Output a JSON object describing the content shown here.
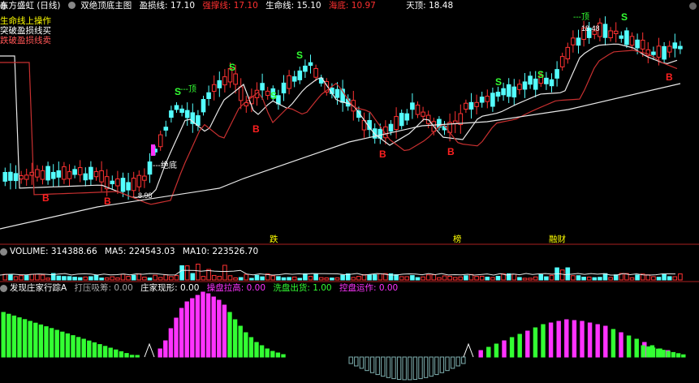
{
  "main": {
    "stock_name": "东方盛虹 (日线)",
    "indicator_name": "双绝顶底主图",
    "params": [
      {
        "label": "盈损线: 17.10",
        "color": "#ffffff"
      },
      {
        "label": "强撑线: 17.10",
        "color": "#ff3030"
      },
      {
        "label": "生命线: 15.10",
        "color": "#ffffff"
      },
      {
        "label": "海底: 10.97",
        "color": "#ff3030"
      },
      {
        "label": "天顶: 18.48",
        "color": "#ffffff"
      }
    ],
    "legend": [
      {
        "text": "生命线上操作",
        "color": "#ffff00"
      },
      {
        "text": "突破盈损线买",
        "color": "#ffffff"
      },
      {
        "text": "跌破盈损线卖",
        "color": "#ff5555"
      }
    ],
    "markers": {
      "s": "S",
      "b": "B",
      "top": "---顶",
      "bottom": "---绝底",
      "low_price": "8.98",
      "high_price": "18.48"
    },
    "bottom_labels": [
      "跌",
      "榜",
      "融财"
    ],
    "colors": {
      "up": "#ff3232",
      "down": "#54ffff",
      "line_white": "#e8e8e8",
      "line_red": "#c83030",
      "s_mark": "#33ff33",
      "b_mark": "#ff2020"
    }
  },
  "volume": {
    "label": "VOLUME: 314388.66",
    "ma5": "MA5: 224543.03",
    "ma10": "MA10: 223526.70"
  },
  "indicator": {
    "title": "发现庄家行踪A",
    "items": [
      {
        "text": "打压吸筹: 0.00",
        "color": "#aaaaaa"
      },
      {
        "text": "庄家现形: 0.00",
        "color": "#ffffff"
      },
      {
        "text": "操盘拉高: 0.00",
        "color": "#ff33ff"
      },
      {
        "text": "洗盘出货: 1.00",
        "color": "#33ff33"
      },
      {
        "text": "控盘运作: 0.00",
        "color": "#ff33ff"
      }
    ],
    "colors": {
      "magenta": "#ff33ff",
      "green": "#33ff33",
      "gray": "#7fb0b0"
    }
  }
}
